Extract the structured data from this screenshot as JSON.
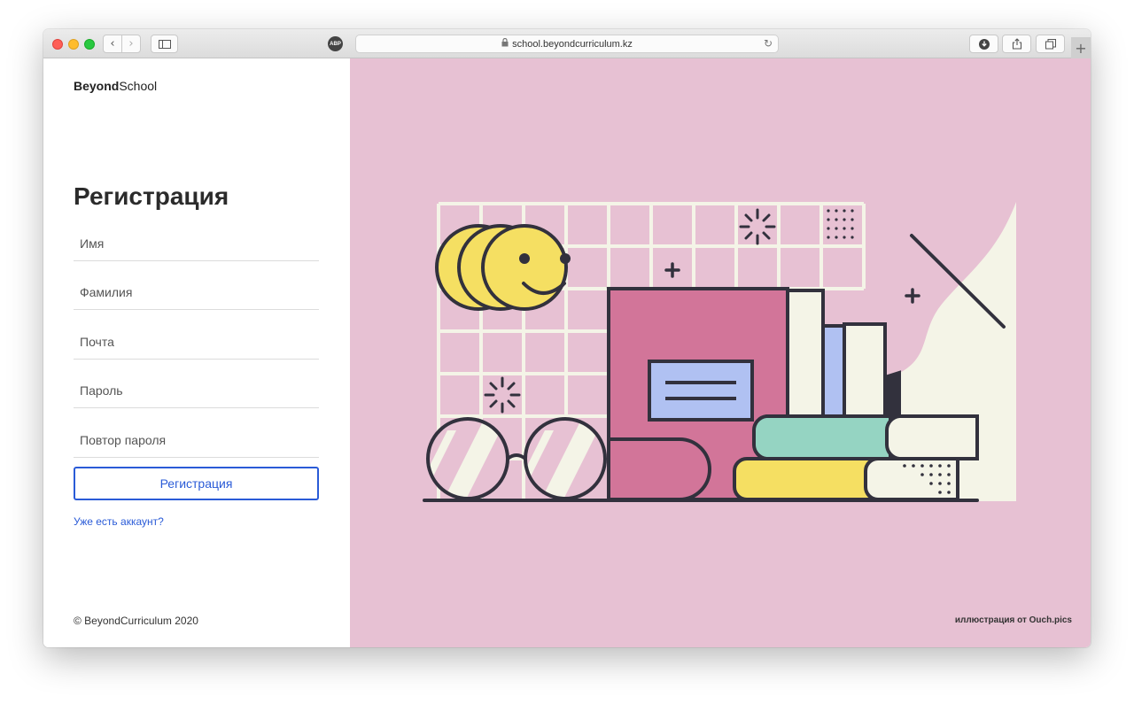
{
  "browser": {
    "url": "school.beyondcurriculum.kz",
    "abp_label": "ABP",
    "back_glyph": "‹",
    "forward_glyph": "›",
    "lock_glyph": "🔒",
    "reload_glyph": "↻",
    "new_tab_glyph": "+",
    "icons": [
      "back-icon",
      "forward-icon",
      "sidebar-icon",
      "adblock-icon",
      "lock-icon",
      "reload-icon",
      "download-icon",
      "share-icon",
      "tabs-icon",
      "new-tab-icon"
    ]
  },
  "brand": {
    "bold": "Beyond",
    "regular": "School"
  },
  "form": {
    "title": "Регистрация",
    "fields": [
      {
        "placeholder": "Имя"
      },
      {
        "placeholder": "Фамилия"
      },
      {
        "placeholder": "Почта"
      },
      {
        "placeholder": "Пароль"
      },
      {
        "placeholder": "Повтор пароля"
      }
    ],
    "submit_label": "Регистрация",
    "login_link": "Уже есть аккаунт?"
  },
  "footer": {
    "copyright": "© BeyondCurriculum 2020",
    "credit": "иллюстрация от Ouch.pics"
  },
  "colors": {
    "accent": "#2a5bd7",
    "illustration_bg": "#e7c1d3",
    "book_pink": "#d27599",
    "smiley_yellow": "#f5df62",
    "book_teal": "#95d4c2",
    "book_blue": "#b0c1f2",
    "cream": "#f4f4e7",
    "outline": "#32313d"
  }
}
